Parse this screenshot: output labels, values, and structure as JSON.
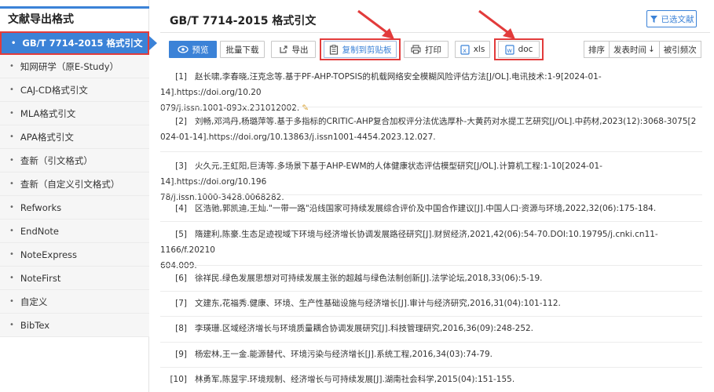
{
  "sidebar": {
    "title": "文献导出格式",
    "items": [
      {
        "label": "GB/T 7714-2015 格式引文",
        "active": true
      },
      {
        "label": "知网研学（原E-Study）"
      },
      {
        "label": "CAJ-CD格式引文"
      },
      {
        "label": "MLA格式引文"
      },
      {
        "label": "APA格式引文"
      },
      {
        "label": "查新（引文格式）"
      },
      {
        "label": "查新（自定义引文格式）"
      },
      {
        "label": "Refworks"
      },
      {
        "label": "EndNote"
      },
      {
        "label": "NoteExpress"
      },
      {
        "label": "NoteFirst"
      },
      {
        "label": "自定义"
      },
      {
        "label": "BibTex"
      }
    ]
  },
  "main": {
    "title": "GB/T 7714-2015 格式引文",
    "selected_docs_label": "已选文献"
  },
  "toolbar": {
    "preview": "预览",
    "batch_download": "批量下载",
    "export": "导出",
    "copy": "复制到剪贴板",
    "print": "打印",
    "xls": "xls",
    "doc": "doc",
    "sort": "排序",
    "pub_time": "发表时间",
    "cited": "被引频次"
  },
  "references": [
    {
      "num": "[1]",
      "line1": "赵长啸,李春晓,汪克念等.基于PF-AHP-TOPSIS的机载网络安全模糊风险评估方法[J/OL].电讯技术:1-9[2024-01-14].https://doi.org/10.20",
      "line2": "079/j.issn.1001-893x.231012002."
    },
    {
      "num": "[2]",
      "line1": "刘畅,邓鸿丹,杨璐萍等.基于多指标的CRITIC-AHP复合加权评分法优选厚朴-大黄药对水提工艺研究[J/OL].中药材,2023(12):3068-3075[2",
      "line2": "024-01-14].https://doi.org/10.13863/j.issn1001-4454.2023.12.027."
    },
    {
      "num": "[3]",
      "line1": "火久元,王虹阳,巨涛等.多场景下基于AHP-EWM的人体健康状态评估模型研究[J/OL].计算机工程:1-10[2024-01-14].https://doi.org/10.196",
      "line2": "78/j.issn.1000-3428.0068282."
    },
    {
      "num": "[4]",
      "line1": "区浩驰,郭凯迪,王灿.\"一带一路\"沿线国家可持续发展综合评价及中国合作建议[J].中国人口·资源与环境,2022,32(06):175-184.",
      "line2": ""
    },
    {
      "num": "[5]",
      "line1": "隋建利,陈豪.生态足迹视域下环境与经济增长协调发展路径研究[J].财贸经济,2021,42(06):54-70.DOI:10.19795/j.cnki.cn11-1166/f.20210",
      "line2": "604.009."
    },
    {
      "num": "[6]",
      "line1": "徐祥民.绿色发展思想对可持续发展主张的超越与绿色法制创新[J].法学论坛,2018,33(06):5-19.",
      "line2": ""
    },
    {
      "num": "[7]",
      "line1": "文建东,花福秀.健康、环境、生产性基础设施与经济增长[J].审计与经济研究,2016,31(04):101-112.",
      "line2": ""
    },
    {
      "num": "[8]",
      "line1": "李瑛珊.区域经济增长与环境质量耦合协调发展研究[J].科技管理研究,2016,36(09):248-252.",
      "line2": ""
    },
    {
      "num": "[9]",
      "line1": "杨宏林,王一金.能源替代、环境污染与经济增长[J].系统工程,2016,34(03):74-79.",
      "line2": ""
    },
    {
      "num": "[10]",
      "line1": "林勇军,陈昱宇.环境规制、经济增长与可持续发展[J].湖南社会科学,2015(04):151-155.",
      "line2": ""
    }
  ],
  "colors": {
    "accent": "#3b82d7",
    "highlight": "#e23b3b"
  }
}
